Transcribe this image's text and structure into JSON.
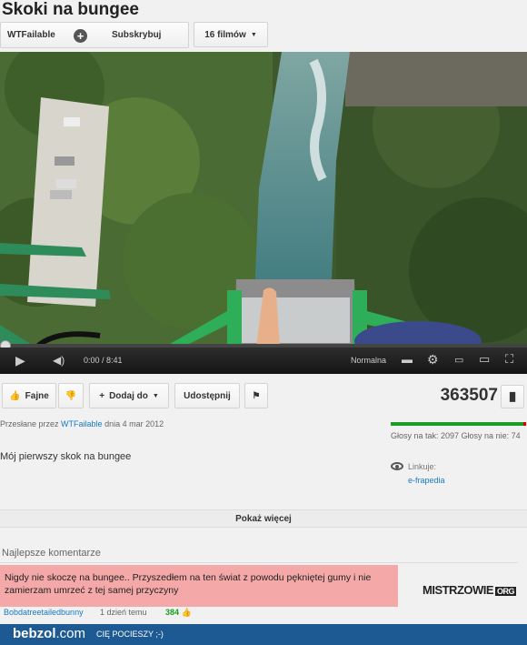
{
  "video": {
    "title": "Skoki na bungee"
  },
  "channel": {
    "name": "WTFailable",
    "subscribe_label": "Subskrybuj",
    "videos_label": "16 filmów"
  },
  "player": {
    "time": "0:00 / 8:41",
    "quality": "Normalna",
    "progress": 0
  },
  "actions": {
    "like_label": "Fajne",
    "add_label": "Dodaj do",
    "share_label": "Udostępnij",
    "views": "363507"
  },
  "upload": {
    "prefix": "Przesłane przez",
    "user": "WTFailable",
    "date": "dnia 4 mar 2012"
  },
  "description": "Mój pierwszy skok na bungee",
  "votes": {
    "text": "Głosy na tak: 2097 Głosy na nie: 74",
    "like_ratio": 0.966
  },
  "links": {
    "label": "Linkuje:",
    "value": "e-frapedia"
  },
  "show_more": "Pokaż więcej",
  "comments": {
    "heading": "Najlepsze komentarze",
    "top": {
      "text": "Nigdy nie skoczę na bungee..  Przyszedłem na ten świat z powodu pękniętej gumy i nie zamierzam umrzeć z tej samej przyczyny",
      "author": "Bobdatreetailedbunny",
      "time": "1 dzień temu",
      "likes": "384"
    }
  },
  "watermark": {
    "main": "MISTRZOWIE",
    "suffix": "ORG"
  },
  "footer": {
    "logo": "bebzol",
    "logo_domain": ".com",
    "slogan": "CIĘ POCIESZY ;-)"
  },
  "colors": {
    "link": "#167ac6",
    "likes_green": "#1b9d25",
    "footer_blue": "#1d5a93",
    "highlight_pink": "#f4a8a8"
  }
}
